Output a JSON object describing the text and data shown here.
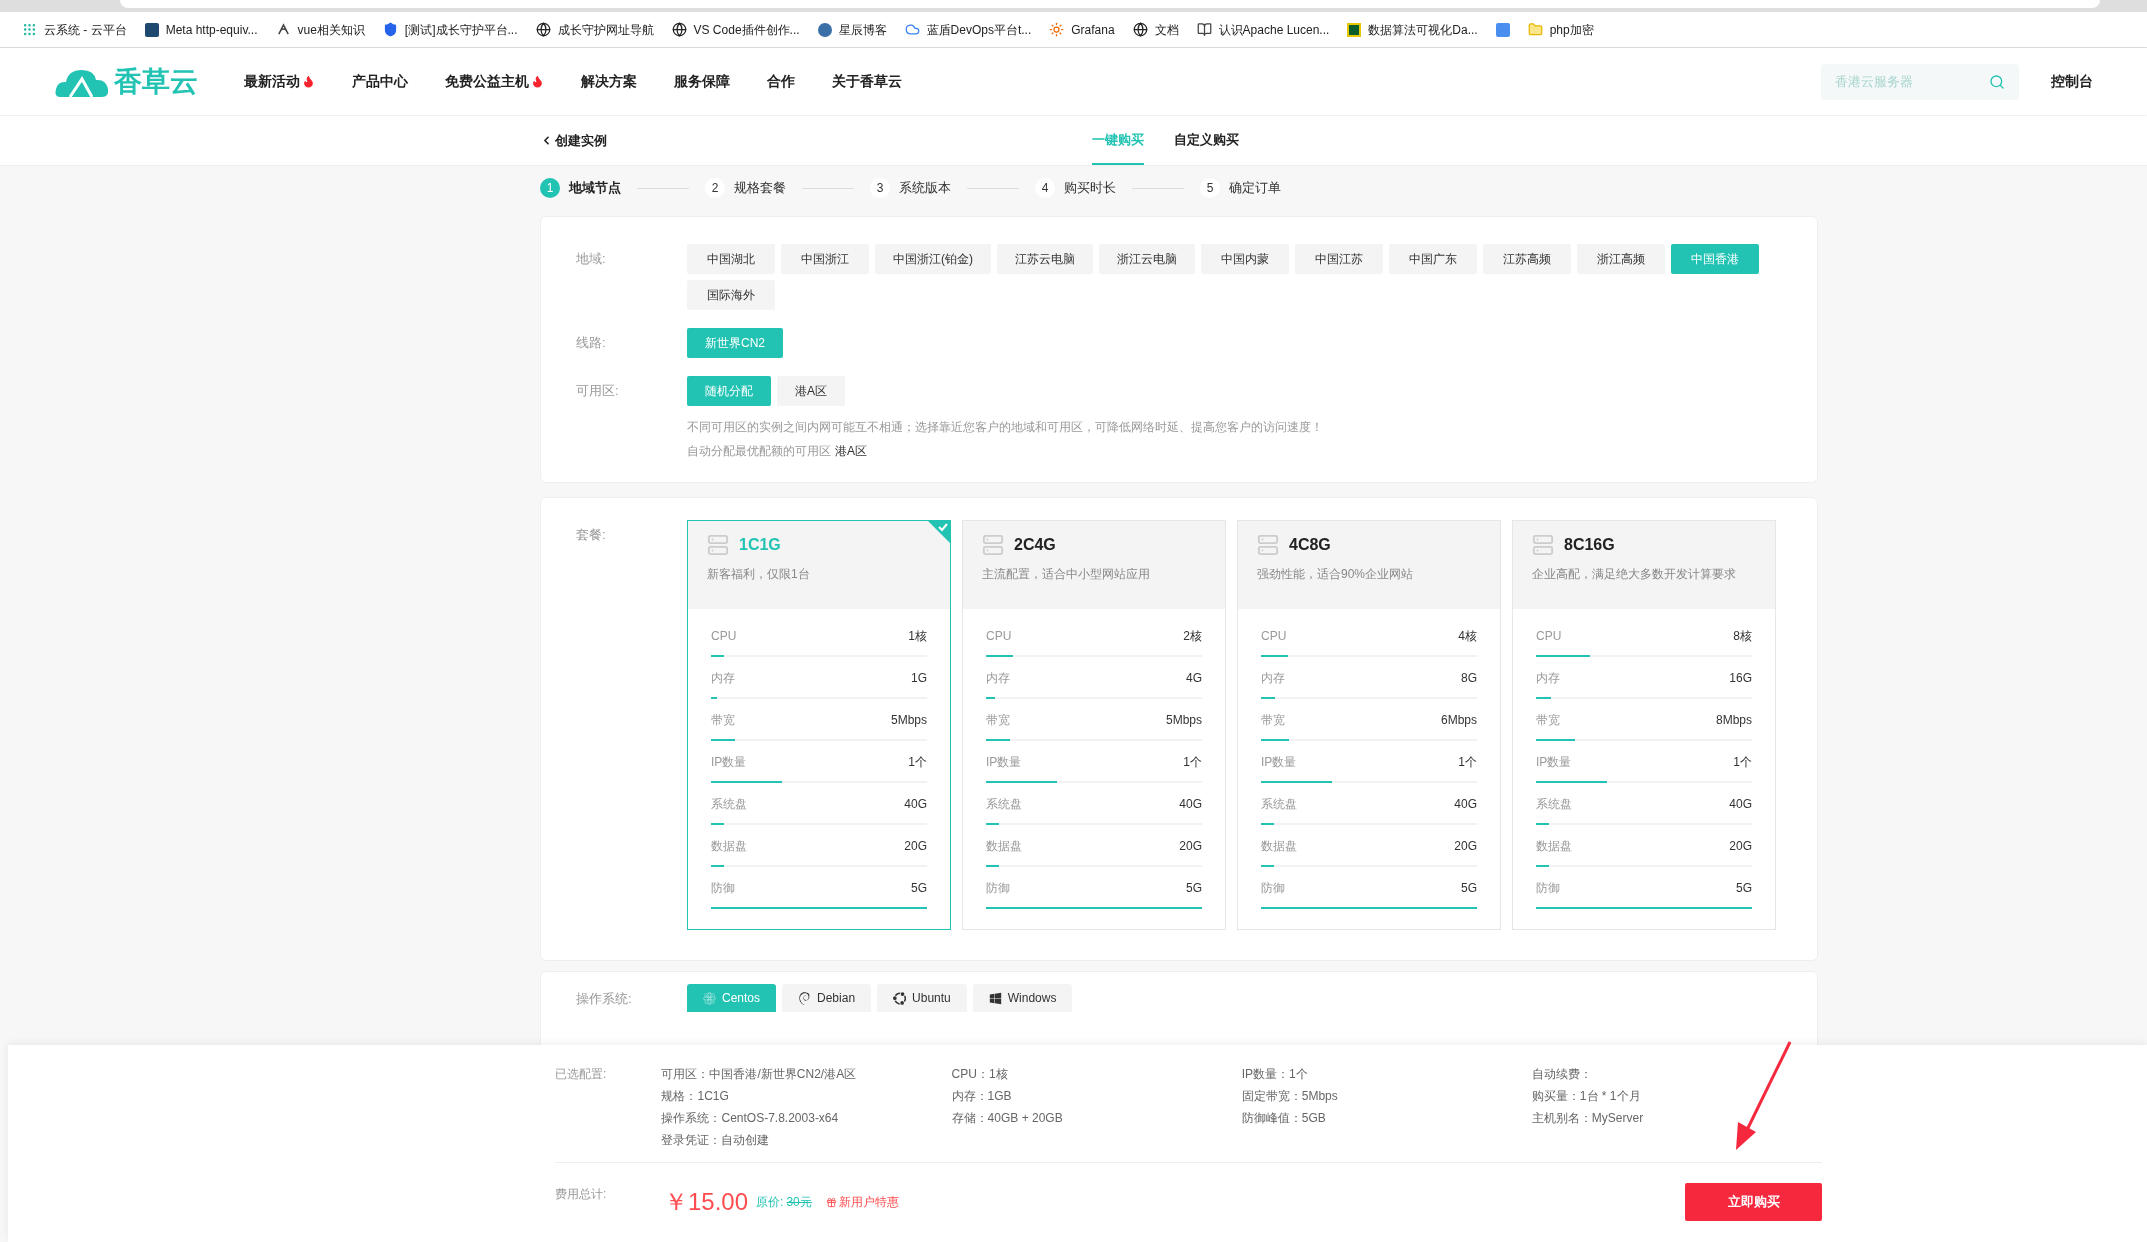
{
  "bookmarks": [
    "云系统 - 云平台",
    "Meta http-equiv...",
    "vue相关知识",
    "[测试]成长守护平台...",
    "成长守护网址导航",
    "VS Code插件创作...",
    "星辰博客",
    "蓝盾DevOps平台t...",
    "Grafana",
    "文档",
    "认识Apache Lucen...",
    "数据算法可视化Da...",
    "php加密"
  ],
  "header": {
    "logo": "香草云",
    "nav": [
      {
        "label": "最新活动",
        "hot": true
      },
      {
        "label": "产品中心",
        "hot": false
      },
      {
        "label": "免费公益主机",
        "hot": true
      },
      {
        "label": "解决方案",
        "hot": false
      },
      {
        "label": "服务保障",
        "hot": false
      },
      {
        "label": "合作",
        "hot": false
      },
      {
        "label": "关于香草云",
        "hot": false
      }
    ],
    "search": {
      "placeholder": "香港云服务器"
    },
    "console": "控制台"
  },
  "subheader": {
    "back": "创建实例",
    "tabs": [
      {
        "label": "一键购买",
        "selected": true
      },
      {
        "label": "自定义购买",
        "selected": false
      }
    ]
  },
  "steps": [
    {
      "number": "1",
      "label": "地域节点",
      "selected": true
    },
    {
      "number": "2",
      "label": "规格套餐",
      "selected": false
    },
    {
      "number": "3",
      "label": "系统版本",
      "selected": false
    },
    {
      "number": "4",
      "label": "购买时长",
      "selected": false
    },
    {
      "number": "5",
      "label": "确定订单",
      "selected": false
    }
  ],
  "region": {
    "label": "地域:",
    "options": [
      {
        "label": "中国湖北",
        "selected": false
      },
      {
        "label": "中国浙江",
        "selected": false
      },
      {
        "label": "中国浙江(铂金)",
        "selected": false
      },
      {
        "label": "江苏云电脑",
        "selected": false
      },
      {
        "label": "浙江云电脑",
        "selected": false
      },
      {
        "label": "中国内蒙",
        "selected": false
      },
      {
        "label": "中国江苏",
        "selected": false
      },
      {
        "label": "中国广东",
        "selected": false
      },
      {
        "label": "江苏高频",
        "selected": false
      },
      {
        "label": "浙江高频",
        "selected": false
      },
      {
        "label": "中国香港",
        "selected": true
      },
      {
        "label": "国际海外",
        "selected": false
      }
    ]
  },
  "line": {
    "label": "线路:",
    "options": [
      {
        "label": "新世界CN2",
        "selected": true
      }
    ]
  },
  "zone": {
    "label": "可用区:",
    "options": [
      {
        "label": "随机分配",
        "selected": true
      },
      {
        "label": "港A区",
        "selected": false
      }
    ],
    "note": "不同可用区的实例之间内网可能互不相通；选择靠近您客户的地域和可用区，可降低网络时延、提高您客户的访问速度！",
    "auto_note": "自动分配最优配额的可用区",
    "auto_zone": "港A区"
  },
  "package": {
    "label": "套餐:",
    "cards": [
      {
        "name": "1C1G",
        "desc": "新客福利，仅限1台",
        "selected": true,
        "specs": [
          {
            "label": "CPU",
            "value": "1核",
            "level": 0.06
          },
          {
            "label": "内存",
            "value": "1G",
            "level": 0.03
          },
          {
            "label": "带宽",
            "value": "5Mbps",
            "level": 0.11
          },
          {
            "label": "IP数量",
            "value": "1个",
            "level": 0.33
          },
          {
            "label": "系统盘",
            "value": "40G",
            "level": 0.06
          },
          {
            "label": "数据盘",
            "value": "20G",
            "level": 0.06
          },
          {
            "label": "防御",
            "value": "5G",
            "level": 1
          }
        ]
      },
      {
        "name": "2C4G",
        "desc": "主流配置，适合中小型网站应用",
        "selected": false,
        "specs": [
          {
            "label": "CPU",
            "value": "2核",
            "level": 0.125
          },
          {
            "label": "内存",
            "value": "4G",
            "level": 0.04
          },
          {
            "label": "带宽",
            "value": "5Mbps",
            "level": 0.11
          },
          {
            "label": "IP数量",
            "value": "1个",
            "level": 0.33
          },
          {
            "label": "系统盘",
            "value": "40G",
            "level": 0.06
          },
          {
            "label": "数据盘",
            "value": "20G",
            "level": 0.06
          },
          {
            "label": "防御",
            "value": "5G",
            "level": 1
          }
        ]
      },
      {
        "name": "4C8G",
        "desc": "强劲性能，适合90%企业网站",
        "selected": false,
        "specs": [
          {
            "label": "CPU",
            "value": "4核",
            "level": 0.125
          },
          {
            "label": "内存",
            "value": "8G",
            "level": 0.065
          },
          {
            "label": "带宽",
            "value": "6Mbps",
            "level": 0.13
          },
          {
            "label": "IP数量",
            "value": "1个",
            "level": 0.33
          },
          {
            "label": "系统盘",
            "value": "40G",
            "level": 0.06
          },
          {
            "label": "数据盘",
            "value": "20G",
            "level": 0.06
          },
          {
            "label": "防御",
            "value": "5G",
            "level": 1
          }
        ]
      },
      {
        "name": "8C16G",
        "desc": "企业高配，满足绝大多数开发计算要求",
        "selected": false,
        "specs": [
          {
            "label": "CPU",
            "value": "8核",
            "level": 0.25
          },
          {
            "label": "内存",
            "value": "16G",
            "level": 0.07
          },
          {
            "label": "带宽",
            "value": "8Mbps",
            "level": 0.18
          },
          {
            "label": "IP数量",
            "value": "1个",
            "level": 0.33
          },
          {
            "label": "系统盘",
            "value": "40G",
            "level": 0.06
          },
          {
            "label": "数据盘",
            "value": "20G",
            "level": 0.06
          },
          {
            "label": "防御",
            "value": "5G",
            "level": 1
          }
        ]
      }
    ]
  },
  "os": {
    "label": "操作系统:",
    "tabs": [
      {
        "label": "Centos",
        "selected": true
      },
      {
        "label": "Debian",
        "selected": false
      },
      {
        "label": "Ubuntu",
        "selected": false
      },
      {
        "label": "Windows",
        "selected": false
      }
    ]
  },
  "summary": {
    "label": "已选配置:",
    "columns": [
      [
        "可用区：中国香港/新世界CN2/港A区",
        "规格：1C1G",
        "操作系统：CentOS-7.8.2003-x64",
        "登录凭证：自动创建"
      ],
      [
        "CPU：1核",
        "内存：1GB",
        "存储：40GB + 20GB"
      ],
      [
        "IP数量：1个",
        "固定带宽：5Mbps",
        "防御峰值：5GB"
      ],
      [
        "自动续费：",
        "购买量：1台 * 1个月",
        "主机别名：MyServer"
      ]
    ],
    "total_label": "费用总计:",
    "price": "￥15.00",
    "original_label": "原价:",
    "original_price": "30元",
    "promo": "新用户特惠",
    "buy": "立即购买"
  }
}
